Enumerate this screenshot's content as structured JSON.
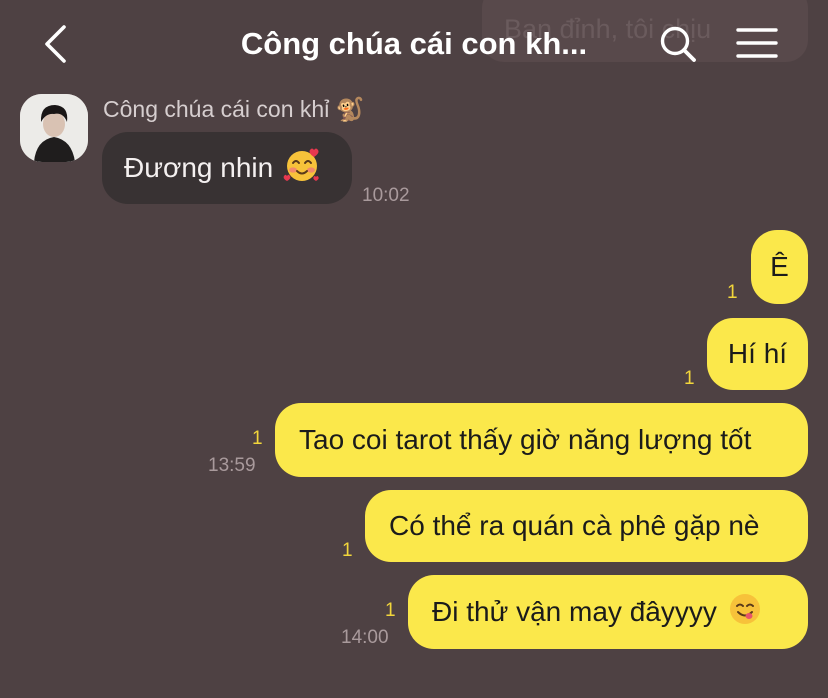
{
  "header": {
    "title": "Công chúa cái con kh...",
    "behind_preview": "Bạn đỉnh, tôi chịu"
  },
  "sender": {
    "name": "Công chúa cái con khỉ 🐒"
  },
  "messages": [
    {
      "text": "Đương nhin",
      "time": "10:02"
    },
    {
      "text": "Ê",
      "unread": "1"
    },
    {
      "text": "Hí hí",
      "unread": "1"
    },
    {
      "text": "Tao coi tarot thấy giờ năng lượng tốt",
      "unread": "1",
      "time": "13:59"
    },
    {
      "text": "Có thể ra quán cà phê gặp nè",
      "unread": "1"
    },
    {
      "text": "Đi thử vận may đâyyyy",
      "unread": "1",
      "time": "14:00"
    }
  ],
  "colors": {
    "background": "#4e4143",
    "incoming_bubble": "#383233",
    "outgoing_bubble": "#fbe84b",
    "unread_count": "#f2d63b"
  },
  "icons": [
    "back-arrow-icon",
    "search-icon",
    "menu-icon",
    "smiling-face-with-hearts-emoji",
    "face-savoring-food-emoji"
  ]
}
